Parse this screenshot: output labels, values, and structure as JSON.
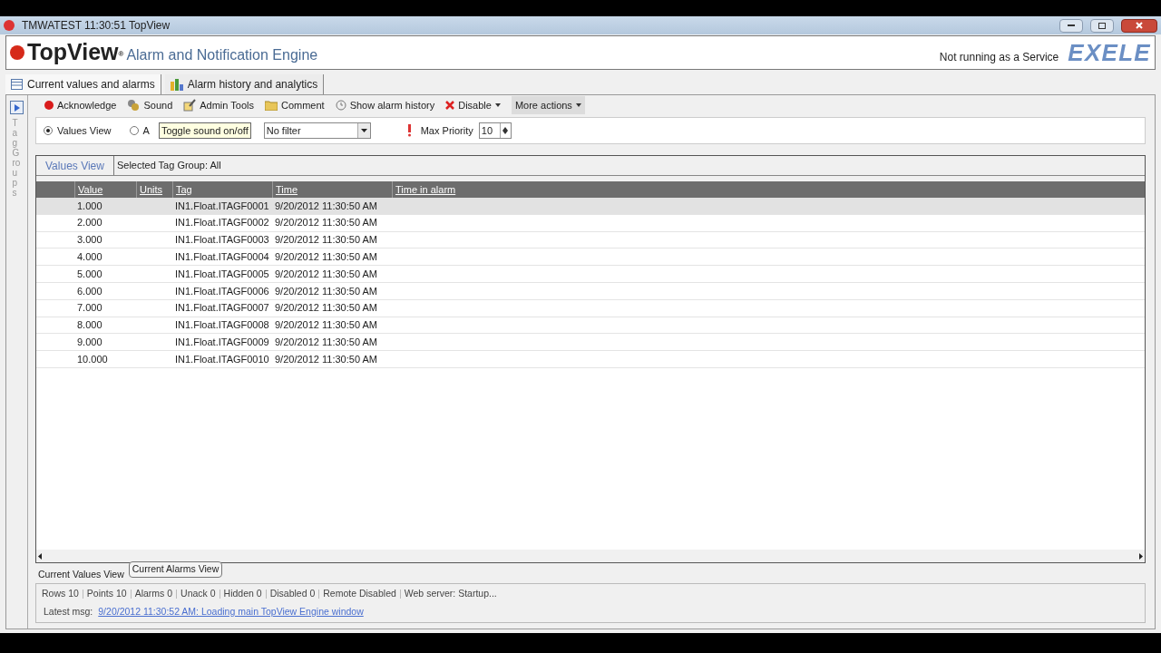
{
  "window": {
    "title": "TMWATEST 11:30:51 TopView"
  },
  "header": {
    "brand": "TopView",
    "registered": "®",
    "subtitle": "Alarm and Notification Engine",
    "service_status": "Not running as a Service",
    "logo_text": "EXELE"
  },
  "tabs": [
    {
      "label": "Current values and alarms",
      "selected": true
    },
    {
      "label": "Alarm history and analytics",
      "selected": false
    }
  ],
  "side_panel": {
    "label": "Tag Groups"
  },
  "toolbar": [
    {
      "kind": "acknowledge",
      "label": "Acknowledge"
    },
    {
      "kind": "sound",
      "label": "Sound"
    },
    {
      "kind": "admin",
      "label": "Admin Tools"
    },
    {
      "kind": "comment",
      "label": "Comment"
    },
    {
      "kind": "history",
      "label": "Show alarm history"
    },
    {
      "kind": "disable",
      "label": "Disable",
      "dropdown": true
    },
    {
      "kind": "more",
      "label": "More actions",
      "dropdown": true
    }
  ],
  "tooltip": "Toggle sound on/off",
  "view_options": [
    {
      "label": "Values View",
      "selected": true
    },
    {
      "label": "A",
      "selected": false
    }
  ],
  "filter": {
    "value": "No filter"
  },
  "max_priority": {
    "label": "Max Priority",
    "value": "10"
  },
  "grid_header": {
    "title": "Values View",
    "group": "Selected Tag Group: All"
  },
  "table": {
    "columns": [
      "Value",
      "Units",
      "Tag",
      "Time",
      "Time in alarm"
    ],
    "rows": [
      {
        "value": "1.000",
        "tag": "IN1.Float.ITAGF0001",
        "time": "9/20/2012 11:30:50 AM",
        "selected": true
      },
      {
        "value": "2.000",
        "tag": "IN1.Float.ITAGF0002",
        "time": "9/20/2012 11:30:50 AM",
        "selected": false
      },
      {
        "value": "3.000",
        "tag": "IN1.Float.ITAGF0003",
        "time": "9/20/2012 11:30:50 AM",
        "selected": false
      },
      {
        "value": "4.000",
        "tag": "IN1.Float.ITAGF0004",
        "time": "9/20/2012 11:30:50 AM",
        "selected": false
      },
      {
        "value": "5.000",
        "tag": "IN1.Float.ITAGF0005",
        "time": "9/20/2012 11:30:50 AM",
        "selected": false
      },
      {
        "value": "6.000",
        "tag": "IN1.Float.ITAGF0006",
        "time": "9/20/2012 11:30:50 AM",
        "selected": false
      },
      {
        "value": "7.000",
        "tag": "IN1.Float.ITAGF0007",
        "time": "9/20/2012 11:30:50 AM",
        "selected": false
      },
      {
        "value": "8.000",
        "tag": "IN1.Float.ITAGF0008",
        "time": "9/20/2012 11:30:50 AM",
        "selected": false
      },
      {
        "value": "9.000",
        "tag": "IN1.Float.ITAGF0009",
        "time": "9/20/2012 11:30:50 AM",
        "selected": false
      },
      {
        "value": "10.000",
        "tag": "IN1.Float.ITAGF0010",
        "time": "9/20/2012 11:30:50 AM",
        "selected": false
      }
    ]
  },
  "bottom_tabs": [
    {
      "label": "Current Values View",
      "selected": true
    },
    {
      "label": "Current Alarms View",
      "selected": false
    }
  ],
  "status_bar": [
    "Rows 10",
    "Points 10",
    "Alarms 0",
    "Unack 0",
    "Hidden 0",
    "Disabled 0",
    "Remote Disabled",
    "Web server: Startup..."
  ],
  "latest_msg": {
    "label": "Latest msg:",
    "link": "9/20/2012 11:30:52 AM: Loading main TopView Engine window"
  }
}
